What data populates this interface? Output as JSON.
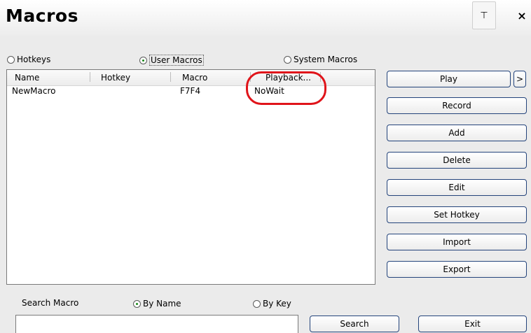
{
  "window": {
    "title": "Macros",
    "pin_glyph": "⊤",
    "close_glyph": "×"
  },
  "filters": {
    "hotkeys": "Hotkeys",
    "user_macros": "User Macros",
    "system_macros": "System Macros",
    "selected": "User Macros"
  },
  "table": {
    "columns": [
      "Name",
      "Hotkey",
      "Macro",
      "Playback..."
    ],
    "rows": [
      {
        "name": "NewMacro",
        "hotkey": "",
        "macro": "F7F4",
        "playback": "NoWait"
      }
    ]
  },
  "buttons": {
    "play": "Play",
    "more": ">",
    "record": "Record",
    "add": "Add",
    "delete": "Delete",
    "edit": "Edit",
    "set_hotkey": "Set Hotkey",
    "import": "Import",
    "export": "Export",
    "search": "Search",
    "exit": "Exit"
  },
  "search": {
    "label": "Search Macro",
    "by_name": "By Name",
    "by_key": "By Key",
    "selected": "By Name",
    "value": ""
  },
  "colors": {
    "annotation_circle": "#e0141a",
    "button_border": "#24447b",
    "radio_selected_dot": "#1a8a1a"
  }
}
